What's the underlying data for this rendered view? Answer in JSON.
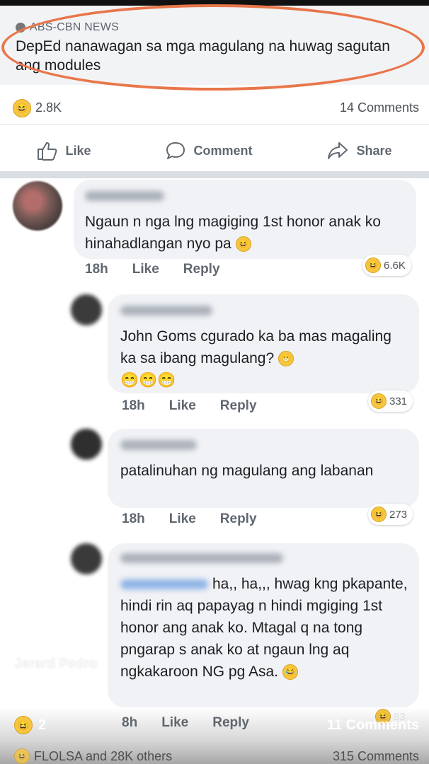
{
  "post": {
    "source": "ABS-CBN NEWS",
    "headline": "DepEd nanawagan sa mga magulang na huwag sagutan ang modules",
    "reaction_count": "2.8K",
    "comment_count": "14 Comments"
  },
  "actions": {
    "like": "Like",
    "comment": "Comment",
    "share": "Share"
  },
  "comments": [
    {
      "text": "Ngaun n  nga lng magiging 1st honor anak ko hinahadlangan nyo pa",
      "emoji_after": "😆",
      "time": "18h",
      "like": "Like",
      "reply": "Reply",
      "reactions": "6.6K"
    },
    {
      "text": "John Goms  cgurado ka ba mas magaling ka sa ibang magulang?",
      "emoji_after": "😁",
      "emoji_line": "😁😁😁",
      "time": "18h",
      "like": "Like",
      "reply": "Reply",
      "reactions": "331"
    },
    {
      "text": "patalinuhan ng magulang ang labanan",
      "time": "18h",
      "like": "Like",
      "reply": "Reply",
      "reactions": "273"
    },
    {
      "text": "ha,, ha,,, hwag kng pkapante, hindi rin aq papayag n hindi mgiging 1st honor ang anak ko. Mtagal q na tong pngarap s anak ko at ngaun lng aq ngkakaroon NG pg Asa.",
      "emoji_after": "😂",
      "time": "8h",
      "like": "Like",
      "reply": "Reply",
      "reactions": "83"
    }
  ],
  "overlay": {
    "watermark": "Jerard Pedro",
    "reaction_count": "2",
    "comments": "11 Comments",
    "reactors": "FLOLSA and 28K others",
    "total_comments": "315 Comments"
  },
  "colors": {
    "highlight": "#e8764a",
    "bubble": "#f0f2f5",
    "reaction": "#f7c640"
  }
}
